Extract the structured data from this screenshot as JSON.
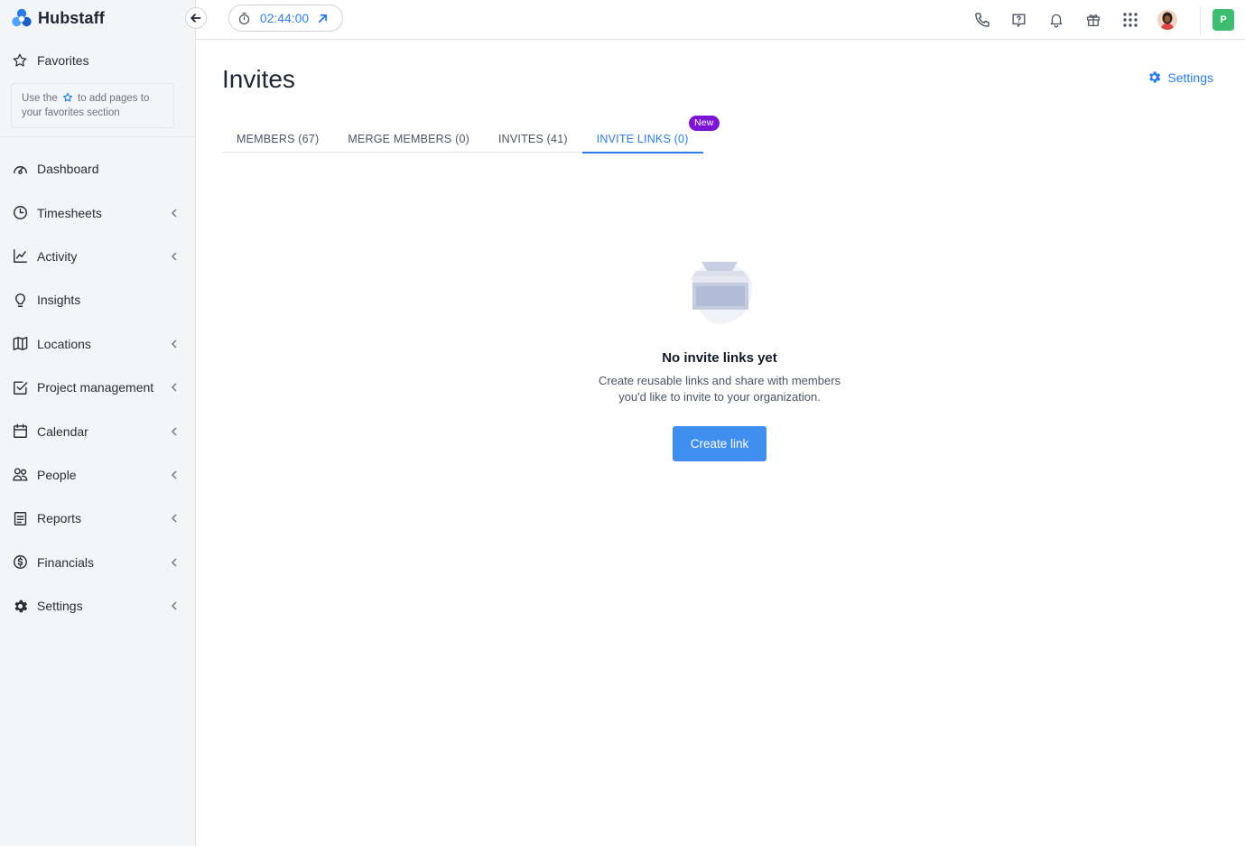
{
  "brand": {
    "name": "Hubstaff"
  },
  "favorites": {
    "label": "Favorites",
    "hint_before": "Use the",
    "hint_after": "to add pages to your favorites section"
  },
  "sidebar": {
    "items": [
      {
        "label": "Dashboard",
        "icon": "dashboard-icon",
        "expandable": false
      },
      {
        "label": "Timesheets",
        "icon": "clock-icon",
        "expandable": true
      },
      {
        "label": "Activity",
        "icon": "activity-chart-icon",
        "expandable": true
      },
      {
        "label": "Insights",
        "icon": "lightbulb-icon",
        "expandable": false
      },
      {
        "label": "Locations",
        "icon": "map-icon",
        "expandable": true
      },
      {
        "label": "Project management",
        "icon": "checkbox-icon",
        "expandable": true
      },
      {
        "label": "Calendar",
        "icon": "calendar-icon",
        "expandable": true
      },
      {
        "label": "People",
        "icon": "people-icon",
        "expandable": true
      },
      {
        "label": "Reports",
        "icon": "report-icon",
        "expandable": true
      },
      {
        "label": "Financials",
        "icon": "dollar-icon",
        "expandable": true
      },
      {
        "label": "Settings",
        "icon": "gear-icon",
        "expandable": true
      }
    ]
  },
  "topbar": {
    "timer": "02:44:00",
    "org_initial": "P"
  },
  "main": {
    "title": "Invites",
    "settings_label": "Settings",
    "tabs": [
      {
        "label": "MEMBERS (67)",
        "active": false
      },
      {
        "label": "MERGE MEMBERS (0)",
        "active": false
      },
      {
        "label": "INVITES (41)",
        "active": false
      },
      {
        "label": "INVITE LINKS (0)",
        "active": true,
        "badge": "New"
      }
    ],
    "empty": {
      "title": "No invite links yet",
      "desc_line1": "Create reusable links and share with members",
      "desc_line2": "you'd like to invite to your organization.",
      "button": "Create link"
    }
  },
  "colors": {
    "accent": "#2b7de9",
    "badge": "#7b14d6",
    "org": "#3dbd6f"
  }
}
